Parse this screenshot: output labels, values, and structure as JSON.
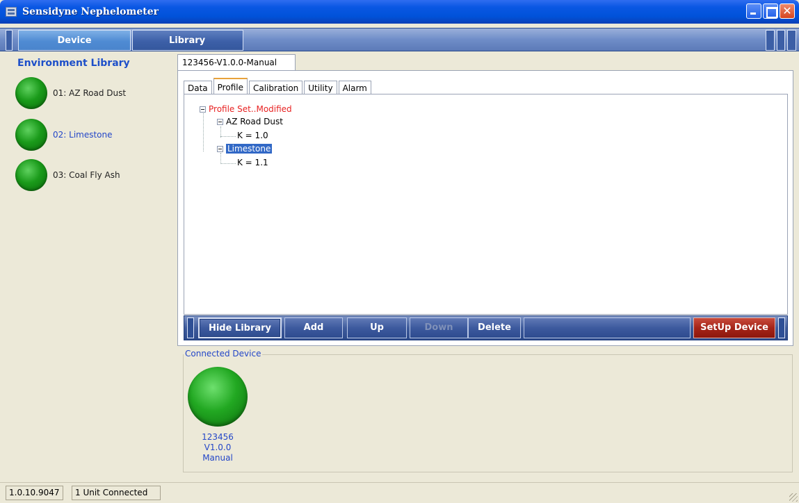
{
  "window": {
    "title": "Sensidyne Nephelometer",
    "controls": [
      "minimize",
      "maximize",
      "close"
    ]
  },
  "nav": {
    "tabs": [
      {
        "label": "Device",
        "active": true
      },
      {
        "label": "Library",
        "active": false
      }
    ]
  },
  "sidebar": {
    "title": "Environment Library",
    "items": [
      {
        "label": "01: AZ Road Dust",
        "active": false
      },
      {
        "label": "02: Limestone",
        "active": true
      },
      {
        "label": "03: Coal Fly Ash",
        "active": false
      }
    ]
  },
  "document": {
    "tab_label": "123456-V1.0.0-Manual",
    "sub_tabs": [
      {
        "label": "Data",
        "active": false
      },
      {
        "label": "Profile",
        "active": true
      },
      {
        "label": "Calibration",
        "active": false
      },
      {
        "label": "Utility",
        "active": false
      },
      {
        "label": "Alarm",
        "active": false
      }
    ],
    "tree": {
      "root": "Profile Set..Modified",
      "nodes": [
        {
          "label": "AZ Road Dust",
          "child": "K = 1.0",
          "selected": false
        },
        {
          "label": "Limestone",
          "child": "K = 1.1",
          "selected": true
        }
      ]
    }
  },
  "toolbar": {
    "hide_library": "Hide Library",
    "add": "Add",
    "up": "Up",
    "down": "Down",
    "delete": "Delete",
    "setup_device": "SetUp Device"
  },
  "connected": {
    "legend": "Connected Device",
    "device_lines": [
      "123456",
      "V1.0.0",
      "Manual"
    ]
  },
  "status": {
    "version": "1.0.10.9047",
    "units": "1 Unit Connected"
  },
  "colors": {
    "accent_blue": "#2346c8",
    "modified_red": "#e82222",
    "selection": "#3168c6",
    "setup_red": "#a52418",
    "status_green": "#1a9a1a"
  }
}
